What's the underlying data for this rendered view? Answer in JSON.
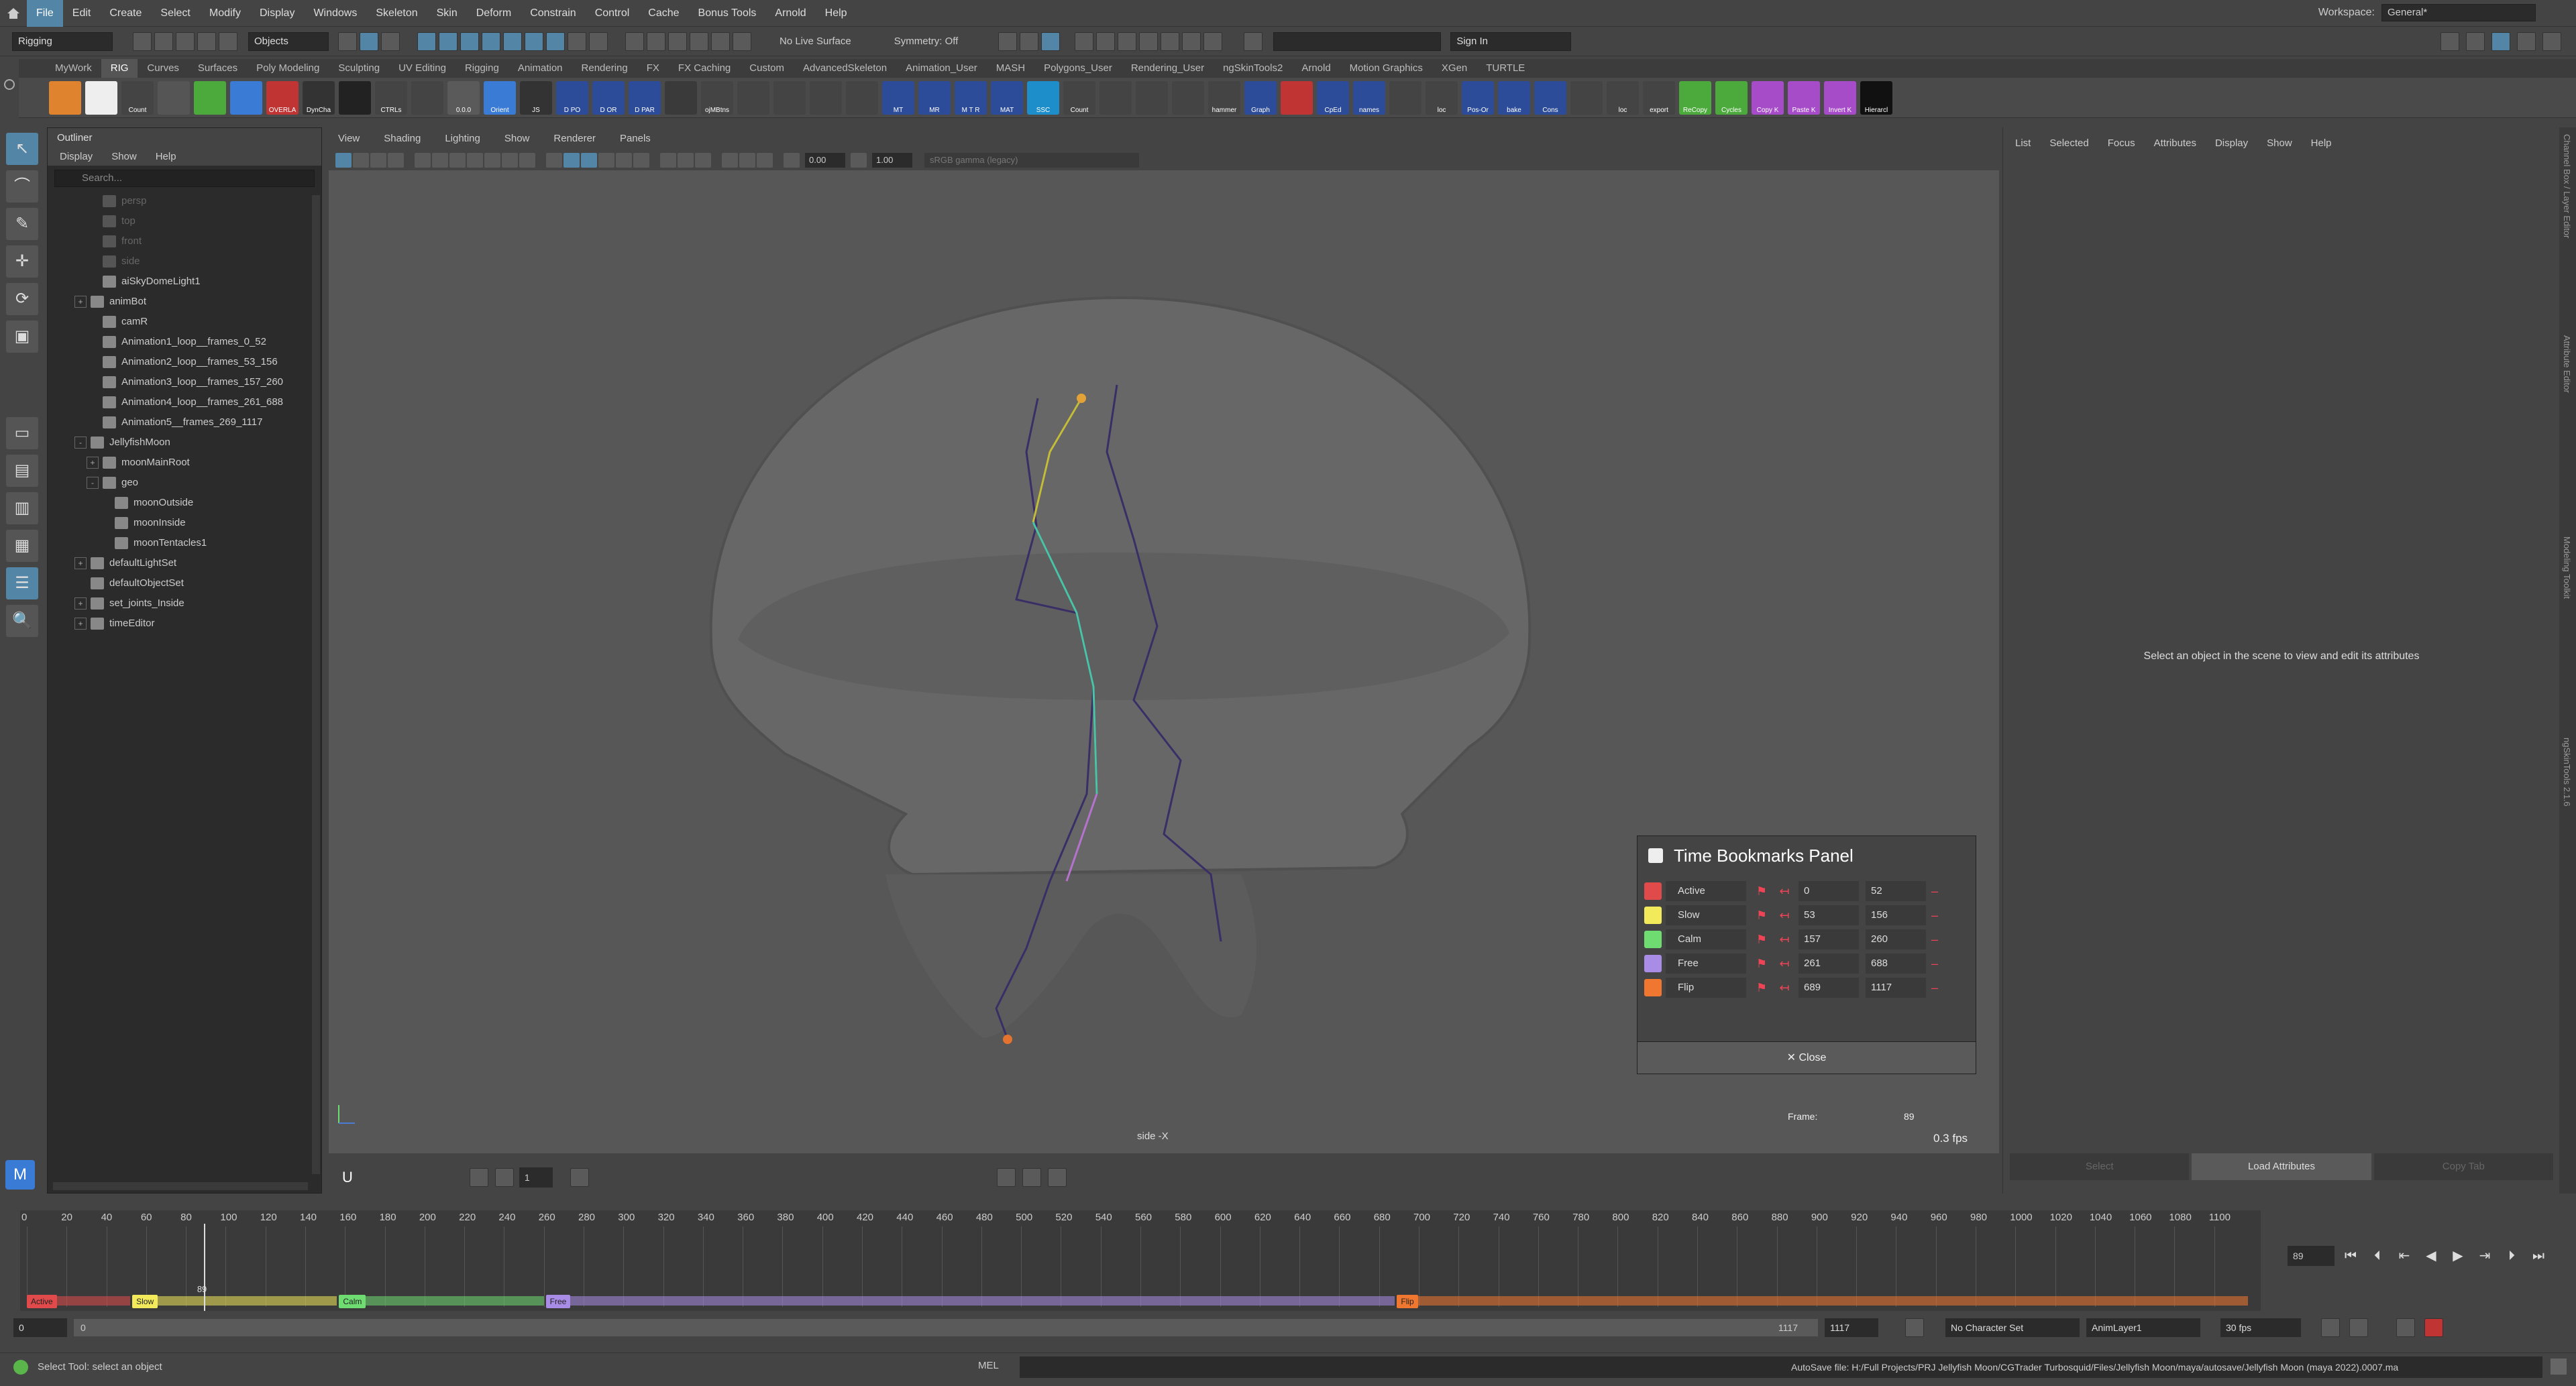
{
  "menubar": {
    "items": [
      "File",
      "Edit",
      "Create",
      "Select",
      "Modify",
      "Display",
      "Windows",
      "Skeleton",
      "Skin",
      "Deform",
      "Constrain",
      "Control",
      "Cache",
      "Bonus Tools",
      "Arnold",
      "Help"
    ],
    "workspace_label": "Workspace:",
    "workspace_value": "General*"
  },
  "statusline": {
    "mode": "Rigging",
    "objects": "Objects",
    "live_surface": "No Live Surface",
    "symmetry": "Symmetry: Off",
    "sign_in": "Sign In"
  },
  "shelf": {
    "tabs": [
      "MyWork",
      "RIG",
      "Curves",
      "Surfaces",
      "Poly Modeling",
      "Sculpting",
      "UV Editing",
      "Rigging",
      "Animation",
      "Rendering",
      "FX",
      "FX Caching",
      "Custom",
      "AdvancedSkeleton",
      "Animation_User",
      "MASH",
      "Polygons_User",
      "Rendering_User",
      "ngSkinTools2",
      "Arnold",
      "Motion Graphics",
      "XGen",
      "TURTLE"
    ],
    "active_tab": "RIG",
    "buttons": [
      "",
      "",
      "Count",
      "",
      "",
      "",
      "OVERLA",
      "DynCha",
      "",
      "CTRLs",
      "",
      "0.0.0",
      "Orient",
      "JS",
      "D PO",
      "D OR",
      "D PAR",
      "",
      "ojMBtns",
      "",
      "",
      "",
      "",
      "MT",
      "MR",
      "M T R",
      "MAT",
      "SSC",
      "Count",
      "",
      "",
      "",
      "hammer",
      "Graph",
      "",
      "CpEd",
      "names",
      "",
      "loc",
      "Pos-Or",
      "bake",
      "Cons",
      "",
      "loc",
      "export",
      "ReCopy",
      "Cycles",
      "Copy K",
      "Paste K",
      "Invert K",
      "Hierarcl"
    ]
  },
  "outliner": {
    "title": "Outliner",
    "menu": [
      "Display",
      "Show",
      "Help"
    ],
    "search_placeholder": "Search...",
    "items": [
      {
        "label": "persp",
        "dim": true,
        "indent": 1,
        "exp": ""
      },
      {
        "label": "top",
        "dim": true,
        "indent": 1,
        "exp": ""
      },
      {
        "label": "front",
        "dim": true,
        "indent": 1,
        "exp": ""
      },
      {
        "label": "side",
        "dim": true,
        "indent": 1,
        "exp": ""
      },
      {
        "label": "aiSkyDomeLight1",
        "dim": false,
        "indent": 1,
        "exp": ""
      },
      {
        "label": "animBot",
        "dim": false,
        "indent": 0,
        "exp": "+"
      },
      {
        "label": "camR",
        "dim": false,
        "indent": 1,
        "exp": ""
      },
      {
        "label": "Animation1_loop__frames_0_52",
        "dim": false,
        "indent": 1,
        "exp": ""
      },
      {
        "label": "Animation2_loop__frames_53_156",
        "dim": false,
        "indent": 1,
        "exp": ""
      },
      {
        "label": "Animation3_loop__frames_157_260",
        "dim": false,
        "indent": 1,
        "exp": ""
      },
      {
        "label": "Animation4_loop__frames_261_688",
        "dim": false,
        "indent": 1,
        "exp": ""
      },
      {
        "label": "Animation5__frames_269_1117",
        "dim": false,
        "indent": 1,
        "exp": ""
      },
      {
        "label": "JellyfishMoon",
        "dim": false,
        "indent": 0,
        "exp": "-"
      },
      {
        "label": "moonMainRoot",
        "dim": false,
        "indent": 1,
        "exp": "+"
      },
      {
        "label": "geo",
        "dim": false,
        "indent": 1,
        "exp": "-"
      },
      {
        "label": "moonOutside",
        "dim": false,
        "indent": 2,
        "exp": ""
      },
      {
        "label": "moonInside",
        "dim": false,
        "indent": 2,
        "exp": ""
      },
      {
        "label": "moonTentacles1",
        "dim": false,
        "indent": 2,
        "exp": ""
      },
      {
        "label": "defaultLightSet",
        "dim": false,
        "indent": 0,
        "exp": "+"
      },
      {
        "label": "defaultObjectSet",
        "dim": false,
        "indent": 0,
        "exp": ""
      },
      {
        "label": "set_joints_Inside",
        "dim": false,
        "indent": 0,
        "exp": "+"
      },
      {
        "label": "timeEditor",
        "dim": false,
        "indent": 0,
        "exp": "+"
      }
    ]
  },
  "viewport": {
    "menu": [
      "View",
      "Shading",
      "Lighting",
      "Show",
      "Renderer",
      "Panels"
    ],
    "near_val": "0.00",
    "far_val": "1.00",
    "color_mgmt": "sRGB gamma (legacy)",
    "camera_label": "side -X",
    "frame_label": "Frame:",
    "frame_value": "89",
    "fps": "0.3 fps"
  },
  "bookmarks_panel": {
    "title": "Time Bookmarks Panel",
    "rows": [
      {
        "name": "Active",
        "color": "#e04a4a",
        "start": "0",
        "end": "52"
      },
      {
        "name": "Slow",
        "color": "#f2ea5a",
        "start": "53",
        "end": "156"
      },
      {
        "name": "Calm",
        "color": "#6fdc72",
        "start": "157",
        "end": "260"
      },
      {
        "name": "Free",
        "color": "#a98ce6",
        "start": "261",
        "end": "688"
      },
      {
        "name": "Flip",
        "color": "#f0772f",
        "start": "689",
        "end": "1117"
      }
    ],
    "close_label": "Close"
  },
  "attribute_editor": {
    "menu": [
      "List",
      "Selected",
      "Focus",
      "Attributes",
      "Display",
      "Show",
      "Help"
    ],
    "message": "Select an object in the scene to view and edit its attributes",
    "buttons": [
      "Select",
      "Load Attributes",
      "Copy Tab"
    ]
  },
  "sidetabs": [
    "Channel Box / Layer Editor",
    "Attribute Editor",
    "Modeling Toolkit",
    "ngSkinTools 2.1.6"
  ],
  "timeline": {
    "ticks": [
      "0",
      "20",
      "40",
      "60",
      "80",
      "100",
      "120",
      "140",
      "160",
      "180",
      "200",
      "220",
      "240",
      "260",
      "280",
      "300",
      "320",
      "340",
      "360",
      "380",
      "400",
      "420",
      "440",
      "460",
      "480",
      "500",
      "520",
      "540",
      "560",
      "580",
      "600",
      "620",
      "640",
      "660",
      "680",
      "700",
      "720",
      "740",
      "760",
      "780",
      "800",
      "820",
      "840",
      "860",
      "880",
      "900",
      "920",
      "940",
      "960",
      "980",
      "1000",
      "1020",
      "1040",
      "1060",
      "1080",
      "1100"
    ],
    "current_frame": "89",
    "current_frame_value": 89,
    "end_frame_value": 1117,
    "bookmarks": [
      {
        "name": "Active",
        "start": 0,
        "end": 52,
        "color": "#e04a4a"
      },
      {
        "name": "Slow",
        "start": 53,
        "end": 156,
        "color": "#f2ea5a"
      },
      {
        "name": "Calm",
        "start": 157,
        "end": 260,
        "color": "#6fdc72"
      },
      {
        "name": "Free",
        "start": 261,
        "end": 688,
        "color": "#a98ce6"
      },
      {
        "name": "Flip",
        "start": 689,
        "end": 1117,
        "color": "#f0772f"
      }
    ],
    "frame_field": "89"
  },
  "range": {
    "start": "0",
    "anim_start": "0",
    "slider_end": "1117",
    "anim_end": "1117",
    "character_set": "No Character Set",
    "anim_layer": "AnimLayer1",
    "fps": "30 fps"
  },
  "helpline": {
    "status": "Select Tool: select an object",
    "mel": "MEL",
    "autosave": "AutoSave file: H:/Full Projects/PRJ Jellyfish Moon/CGTrader Turbosquid/Files/Jellyfish Moon/maya/autosave/Jellyfish Moon (maya 2022).0007.ma"
  }
}
